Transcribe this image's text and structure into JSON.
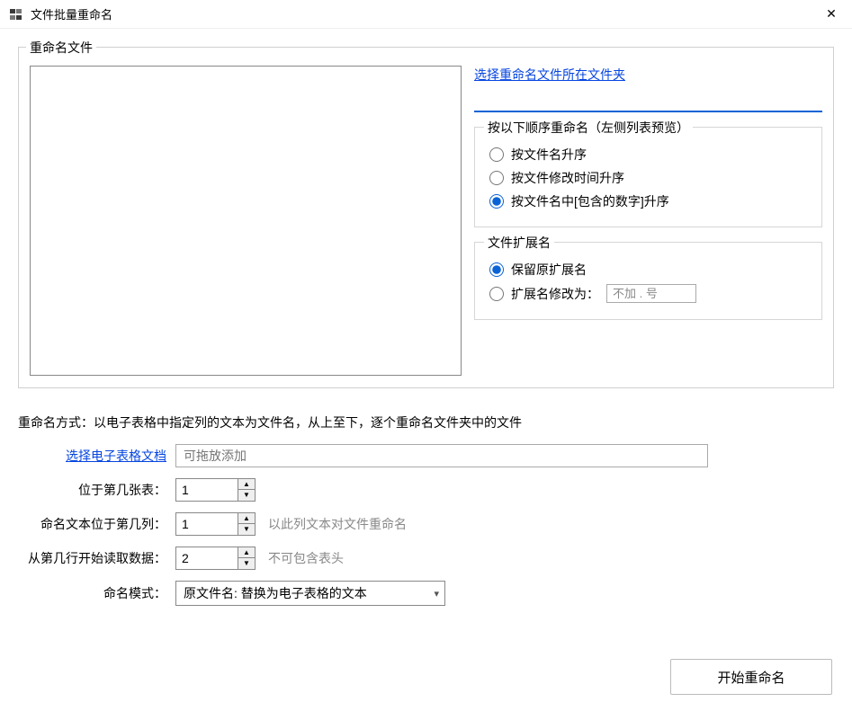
{
  "window": {
    "title": "文件批量重命名"
  },
  "top": {
    "group_legend": "重命名文件",
    "select_folder_link": "选择重命名文件所在文件夹",
    "folder_path": "",
    "order_group_legend": "按以下顺序重命名（左侧列表预览）",
    "order_options": {
      "by_name": "按文件名升序",
      "by_mtime": "按文件修改时间升序",
      "by_number": "按文件名中[包含的数字]升序"
    },
    "order_selected": "by_number",
    "ext_group_legend": "文件扩展名",
    "ext_options": {
      "keep": "保留原扩展名",
      "change": "扩展名修改为："
    },
    "ext_selected": "keep",
    "ext_change_placeholder": "不加 . 号"
  },
  "bottom": {
    "desc_label": "重命名方式：以电子表格中指定列的文本为文件名，从上至下，逐个重命名文件夹中的文件",
    "select_sheet_link": "选择电子表格文档",
    "sheet_path_placeholder": "可拖放添加",
    "sheet_path": "",
    "sheet_index_label": "位于第几张表：",
    "sheet_index": "1",
    "col_index_label": "命名文本位于第几列：",
    "col_index": "1",
    "col_hint": "以此列文本对文件重命名",
    "row_start_label": "从第几行开始读取数据：",
    "row_start": "2",
    "row_hint": "不可包含表头",
    "mode_label": "命名模式：",
    "mode_value": "原文件名: 替换为电子表格的文本"
  },
  "actions": {
    "start": "开始重命名"
  }
}
